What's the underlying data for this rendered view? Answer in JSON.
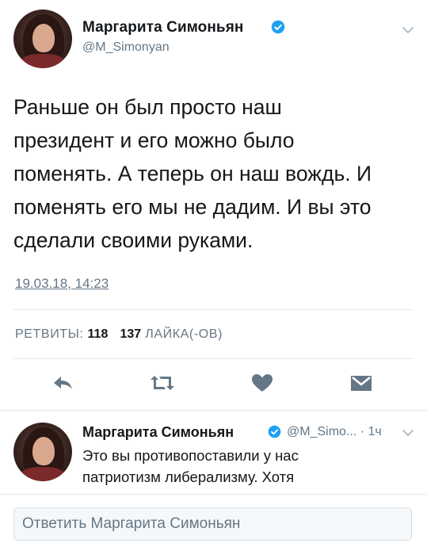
{
  "tweet": {
    "author_name": "Маргарита Симоньян",
    "author_handle": "@M_Simonyan",
    "text": "Раньше он был просто наш\nпрезидент и его можно было\nпоменять. А теперь он наш вождь.  И\nпоменять его мы не дадим. И вы это\nсделали своими руками.",
    "timestamp": "19.03.18, 14:23",
    "retweets_label": "РЕТВИТЫ:",
    "retweets_count": "118",
    "likes_count": "137",
    "likes_label": "ЛАЙКА(-ОВ)",
    "actions": {
      "reply_icon": "reply-icon",
      "retweet_icon": "retweet-icon",
      "like_icon": "heart-icon",
      "dm_icon": "envelope-icon"
    }
  },
  "reply_tweet": {
    "author_name": "Маргарита Симоньян",
    "meta": "@M_Simo... · 1ч",
    "text": "Это вы противопоставили у нас\nпатриотизм либерализму. Хотя"
  },
  "composer": {
    "placeholder": "Ответить Маргарита Симоньян"
  },
  "colors": {
    "verified": "#1da1f2",
    "secondary_text": "#657786",
    "icon": "#657786",
    "divider": "#e1e8ed"
  }
}
